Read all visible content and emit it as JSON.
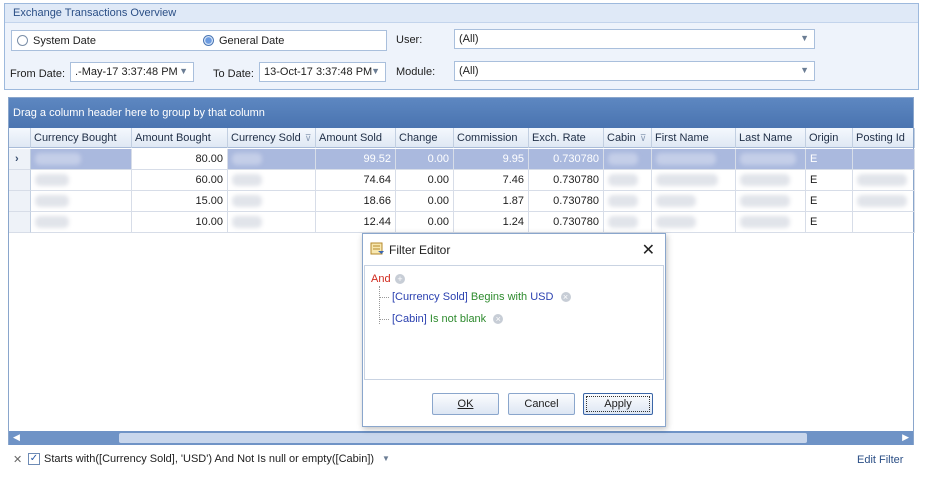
{
  "panel": {
    "caption": "Exchange Transactions Overview",
    "system_date_label": "System Date",
    "general_date_label": "General Date",
    "from_date_label": "From Date:",
    "from_date_value": ".-May-17 3:37:48 PM",
    "to_date_label": "To Date:",
    "to_date_value": "13-Oct-17 3:37:48 PM",
    "user_label": "User:",
    "user_value": "(All)",
    "module_label": "Module:",
    "module_value": "(All)"
  },
  "grid": {
    "group_hint": "Drag a column header here to group by that column",
    "columns": [
      "Currency Bought",
      "Amount Bought",
      "Currency Sold",
      "Amount Sold",
      "Change",
      "Commission",
      "Exch. Rate",
      "Cabin",
      "First Name",
      "Last Name",
      "Origin",
      "Posting Id"
    ],
    "rows": [
      {
        "amount_bought": "80.00",
        "amount_sold": "99.52",
        "change": "0.00",
        "commission": "9.95",
        "exch_rate": "0.730780",
        "origin": "E"
      },
      {
        "amount_bought": "60.00",
        "amount_sold": "74.64",
        "change": "0.00",
        "commission": "7.46",
        "exch_rate": "0.730780",
        "origin": "E"
      },
      {
        "amount_bought": "15.00",
        "amount_sold": "18.66",
        "change": "0.00",
        "commission": "1.87",
        "exch_rate": "0.730780",
        "origin": "E"
      },
      {
        "amount_bought": "10.00",
        "amount_sold": "12.44",
        "change": "0.00",
        "commission": "1.24",
        "exch_rate": "0.730780",
        "origin": "E"
      }
    ]
  },
  "filter_bar": {
    "expression": "Starts with([Currency Sold], 'USD') And Not Is null or empty([Cabin])",
    "edit_filter_label": "Edit Filter"
  },
  "dialog": {
    "title": "Filter Editor",
    "group_op": "And",
    "cond1_field": "[Currency Sold]",
    "cond1_op": "Begins with",
    "cond1_value": "USD",
    "cond2_field": "[Cabin]",
    "cond2_op": "Is not blank",
    "ok_label": "OK",
    "cancel_label": "Cancel",
    "apply_label": "Apply"
  },
  "icons": {
    "filter_editor": "filter-editor-icon",
    "close": "close-icon",
    "expand_row": "row-indicator-icon"
  }
}
